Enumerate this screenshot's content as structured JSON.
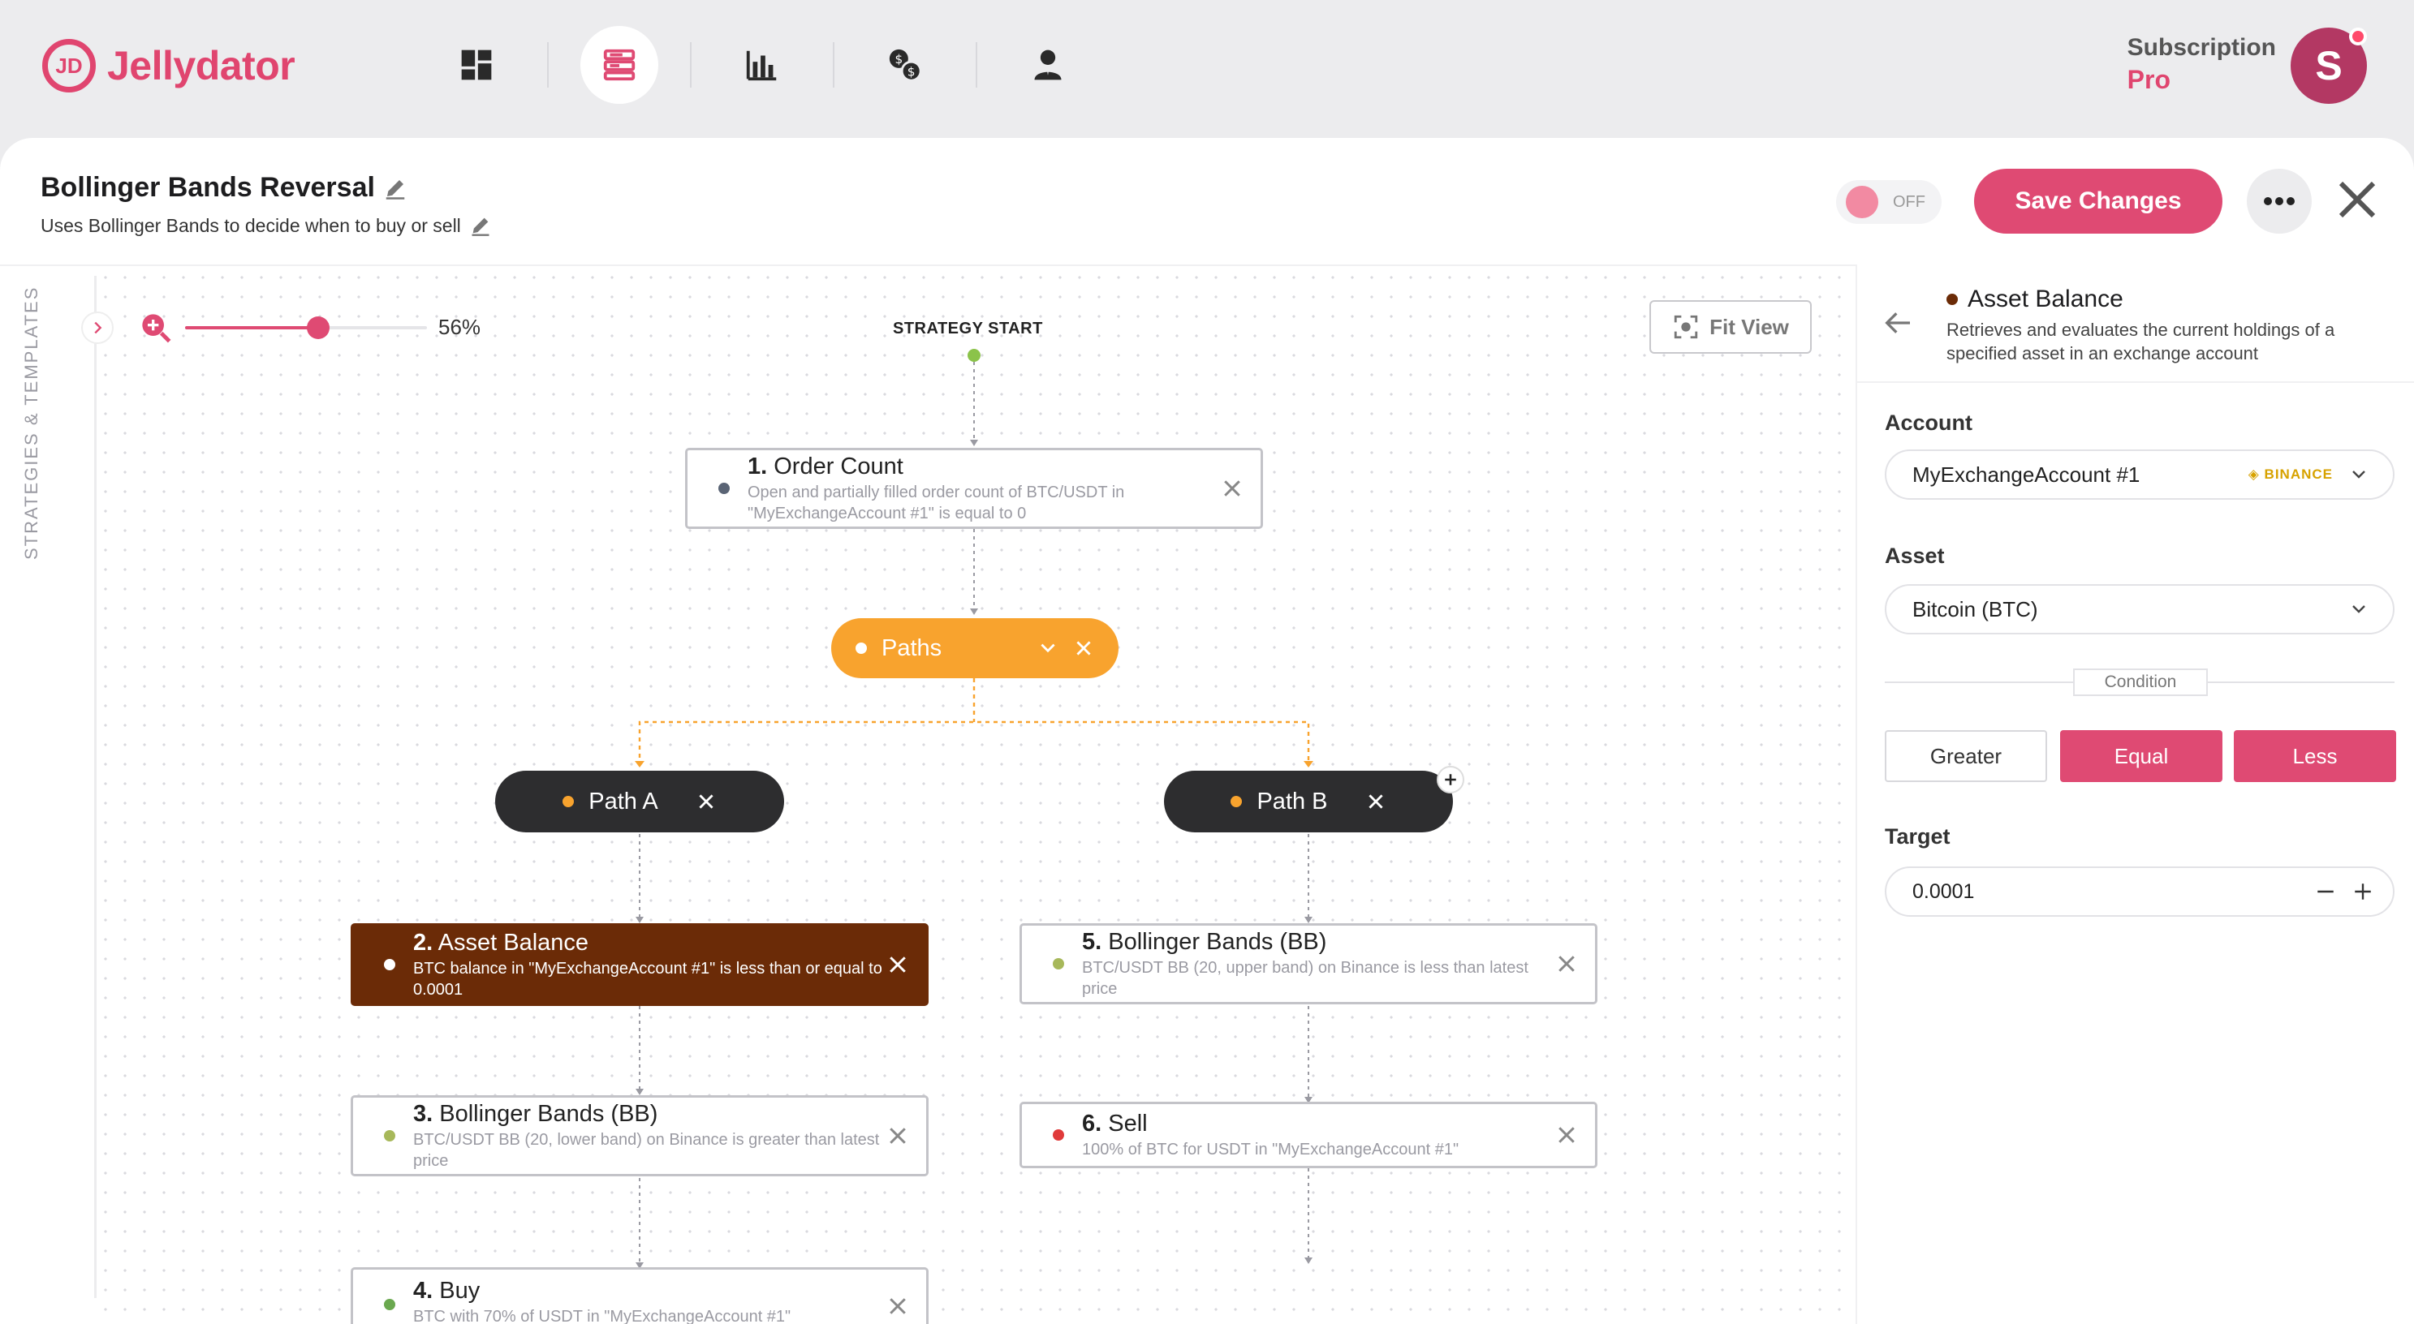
{
  "brand": {
    "name": "Jellydator",
    "mark": "JD"
  },
  "nav": {
    "items": [
      {
        "name": "dashboard",
        "icon": "dashboard-grid-icon"
      },
      {
        "name": "strategies",
        "icon": "strategy-list-icon",
        "active": true
      },
      {
        "name": "analytics",
        "icon": "bar-chart-icon"
      },
      {
        "name": "exchange",
        "icon": "currency-exchange-icon"
      },
      {
        "name": "profile",
        "icon": "user-icon"
      }
    ]
  },
  "subscription": {
    "label": "Subscription",
    "tier": "Pro"
  },
  "user": {
    "initial": "S"
  },
  "strategy": {
    "title": "Bollinger Bands Reversal",
    "description": "Uses Bollinger Bands to decide when to buy or sell",
    "toggle_label": "OFF",
    "save_label": "Save Changes"
  },
  "canvas": {
    "sidebar_label": "STRATEGIES & TEMPLATES",
    "zoom_label": "56%",
    "zoom_value": 0.56,
    "fit_view_label": "Fit View",
    "start_label": "STRATEGY START",
    "paths_label": "Paths",
    "path_a_label": "Path A",
    "path_b_label": "Path B",
    "nodes": [
      {
        "num": "1.",
        "title": "Order Count",
        "desc": "Open and partially filled order count of BTC/USDT in \"MyExchangeAccount #1\" is equal to 0",
        "dot_color": "#5a6475"
      },
      {
        "num": "2.",
        "title": "Asset Balance",
        "desc": "BTC balance in \"MyExchangeAccount #1\" is less than or equal to 0.0001",
        "dot_color": "#ffffff"
      },
      {
        "num": "3.",
        "title": "Bollinger Bands (BB)",
        "desc": "BTC/USDT BB (20, lower band) on Binance is greater than latest price",
        "dot_color": "#a7b85a"
      },
      {
        "num": "4.",
        "title": "Buy",
        "desc": "BTC with 70% of USDT in \"MyExchangeAccount #1\"",
        "dot_color": "#6aa84f"
      },
      {
        "num": "5.",
        "title": "Bollinger Bands (BB)",
        "desc": "BTC/USDT BB (20, upper band) on Binance is less than latest price",
        "dot_color": "#a7b85a"
      },
      {
        "num": "6.",
        "title": "Sell",
        "desc": "100% of BTC for USDT in \"MyExchangeAccount #1\"",
        "dot_color": "#e03a3a"
      }
    ]
  },
  "panel": {
    "title": "Asset Balance",
    "description": "Retrieves and evaluates the current holdings of a specified asset in an exchange account",
    "account_label": "Account",
    "account_value": "MyExchangeAccount #1",
    "exchange_badge": "BINANCE",
    "asset_label": "Asset",
    "asset_value": "Bitcoin (BTC)",
    "condition_label": "Condition",
    "conditions": [
      "Greater",
      "Equal",
      "Less"
    ],
    "target_label": "Target",
    "target_value": "0.0001"
  },
  "colors": {
    "accent": "#df4a73",
    "orange": "#f8a32e",
    "selected_node": "#6b2b07",
    "dark_pill": "#2d2d2f"
  }
}
